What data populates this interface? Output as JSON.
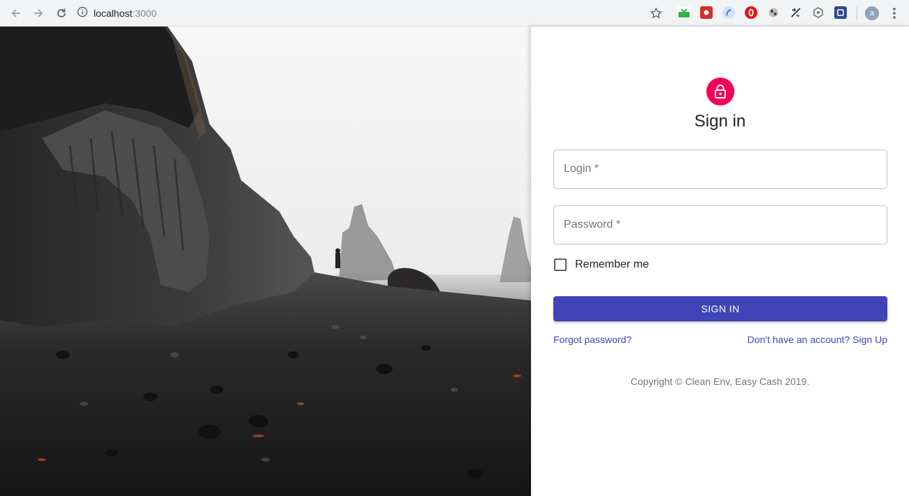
{
  "browser": {
    "url_host": "localhost",
    "url_port": ":3000",
    "avatar_initial": "a"
  },
  "signin": {
    "title": "Sign in",
    "login_label": "Login *",
    "password_label": "Password *",
    "remember_label": "Remember me",
    "remember_checked": false,
    "submit_label": "SIGN IN",
    "forgot_link": "Forgot password?",
    "signup_link": "Don't have an account? Sign Up",
    "copyright": "Copyright © Clean Env, Easy Cash 2019."
  },
  "colors": {
    "accent": "#f50057",
    "primary": "#3f44b6"
  }
}
